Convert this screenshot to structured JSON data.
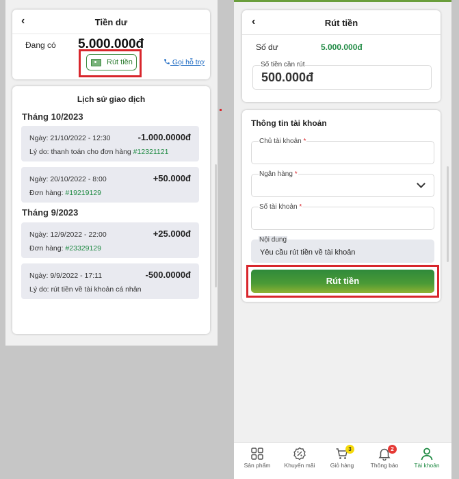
{
  "left": {
    "header": {
      "back_icon": "chevron-left-icon",
      "title": "Tiền dư"
    },
    "balance": {
      "label": "Đang có",
      "amount": "5.000.000đ"
    },
    "withdraw_button": {
      "label": "Rút tiền",
      "icon": "cash-icon"
    },
    "support_link": {
      "label": "Gọi hỗ trợ",
      "icon": "phone-icon"
    },
    "history": {
      "title": "Lịch sử giao dịch",
      "groups": [
        {
          "month": "Tháng 10/2023",
          "items": [
            {
              "date": "Ngày: 21/10/2022 - 12:30",
              "amount": "-1.000.0000đ",
              "note_label": "Lý do: thanh toán cho đơn hàng ",
              "note_link": "#12321121"
            },
            {
              "date": "Ngày: 20/10/2022 - 8:00",
              "amount": "+50.000đ",
              "note_label": "Đơn hàng: ",
              "note_link": "#19219129"
            }
          ]
        },
        {
          "month": "Tháng 9/2023",
          "items": [
            {
              "date": "Ngày: 12/9/2022 - 22:00",
              "amount": "+25.000đ",
              "note_label": "Đơn hàng: ",
              "note_link": "#23329129"
            },
            {
              "date": "Ngày: 9/9/2022 - 17:11",
              "amount": "-500.0000đ",
              "note_label": "Lý do: rút tiền về tài khoản cá nhân",
              "note_link": ""
            }
          ]
        }
      ]
    }
  },
  "right": {
    "header": {
      "back_icon": "chevron-left-icon",
      "title": "Rút tiền"
    },
    "balance": {
      "label": "Số dư",
      "amount": "5.000.000đ"
    },
    "withdraw_amount": {
      "label": "Số tiền cần rút",
      "value": "500.000đ"
    },
    "account_info": {
      "title": "Thông tin tài khoản",
      "owner_label": "Chủ tài khoản",
      "bank_label": "Ngân hàng",
      "account_number_label": "Số tài khoản",
      "content_label": "Nội dung",
      "content_value": "Yêu cầu rút tiền về tài khoản",
      "required_mark": "*"
    },
    "submit_label": "Rút tiền",
    "tabbar": [
      {
        "label": "Sản phẩm",
        "icon": "grid-icon"
      },
      {
        "label": "Khuyến mãi",
        "icon": "discount-icon"
      },
      {
        "label": "Giỏ hàng",
        "icon": "cart-icon",
        "badge": "3"
      },
      {
        "label": "Thông báo",
        "icon": "bell-icon",
        "badge": "2"
      },
      {
        "label": "Tài khoản",
        "icon": "user-icon",
        "active": true
      }
    ]
  },
  "colors": {
    "brand_green": "#1f8a43",
    "highlight_red": "#d8262c",
    "cart_badge": "#f5d90a",
    "notify_badge": "#e53935"
  }
}
